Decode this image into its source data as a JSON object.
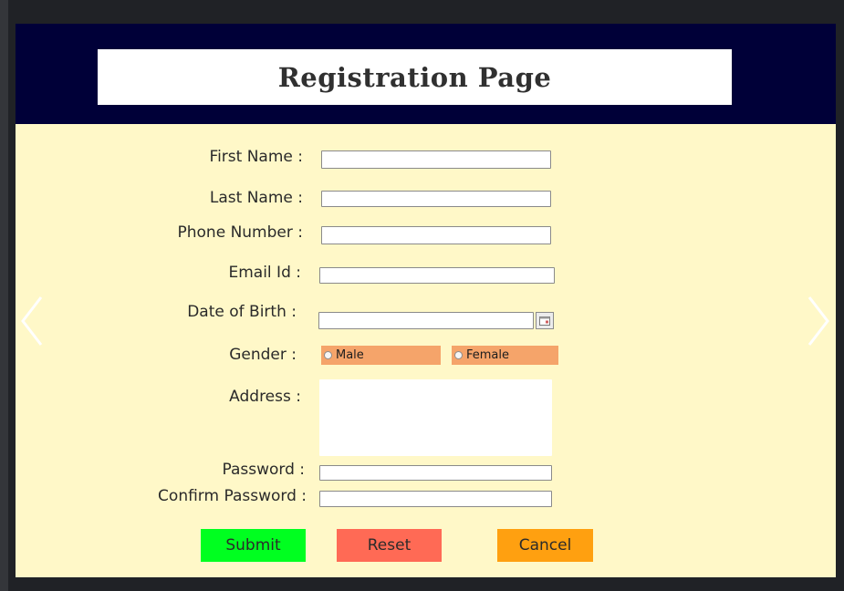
{
  "page": {
    "title": "Registration Page"
  },
  "form": {
    "first_name": {
      "label": "First Name :",
      "value": "",
      "placeholder": ""
    },
    "last_name": {
      "label": "Last Name :",
      "value": "",
      "placeholder": ""
    },
    "phone": {
      "label": "Phone Number :",
      "value": "",
      "placeholder": ""
    },
    "email": {
      "label": "Email Id :",
      "value": "",
      "placeholder": ""
    },
    "dob": {
      "label": "Date of Birth :",
      "value": "",
      "placeholder": "",
      "icon": "calendar-icon"
    },
    "gender": {
      "label": "Gender :",
      "options": [
        {
          "label": "Male",
          "selected": false
        },
        {
          "label": "Female",
          "selected": false
        }
      ]
    },
    "address": {
      "label": "Address :",
      "value": "",
      "placeholder": ""
    },
    "password": {
      "label": "Password :",
      "value": "",
      "placeholder": ""
    },
    "confirm_password": {
      "label": "Confirm Password :",
      "value": "",
      "placeholder": ""
    }
  },
  "buttons": {
    "submit": {
      "label": "Submit",
      "color": "#00ff20"
    },
    "reset": {
      "label": "Reset",
      "color": "#ff6a55"
    },
    "cancel": {
      "label": "Cancel",
      "color": "#ffa010"
    }
  },
  "nav": {
    "prev_icon": "chevron-left-icon",
    "next_icon": "chevron-right-icon"
  },
  "colors": {
    "header_band": "#000038",
    "page_background": "#fff8c8",
    "radio_chip": "#f5a46a",
    "title_text": "#303030"
  }
}
